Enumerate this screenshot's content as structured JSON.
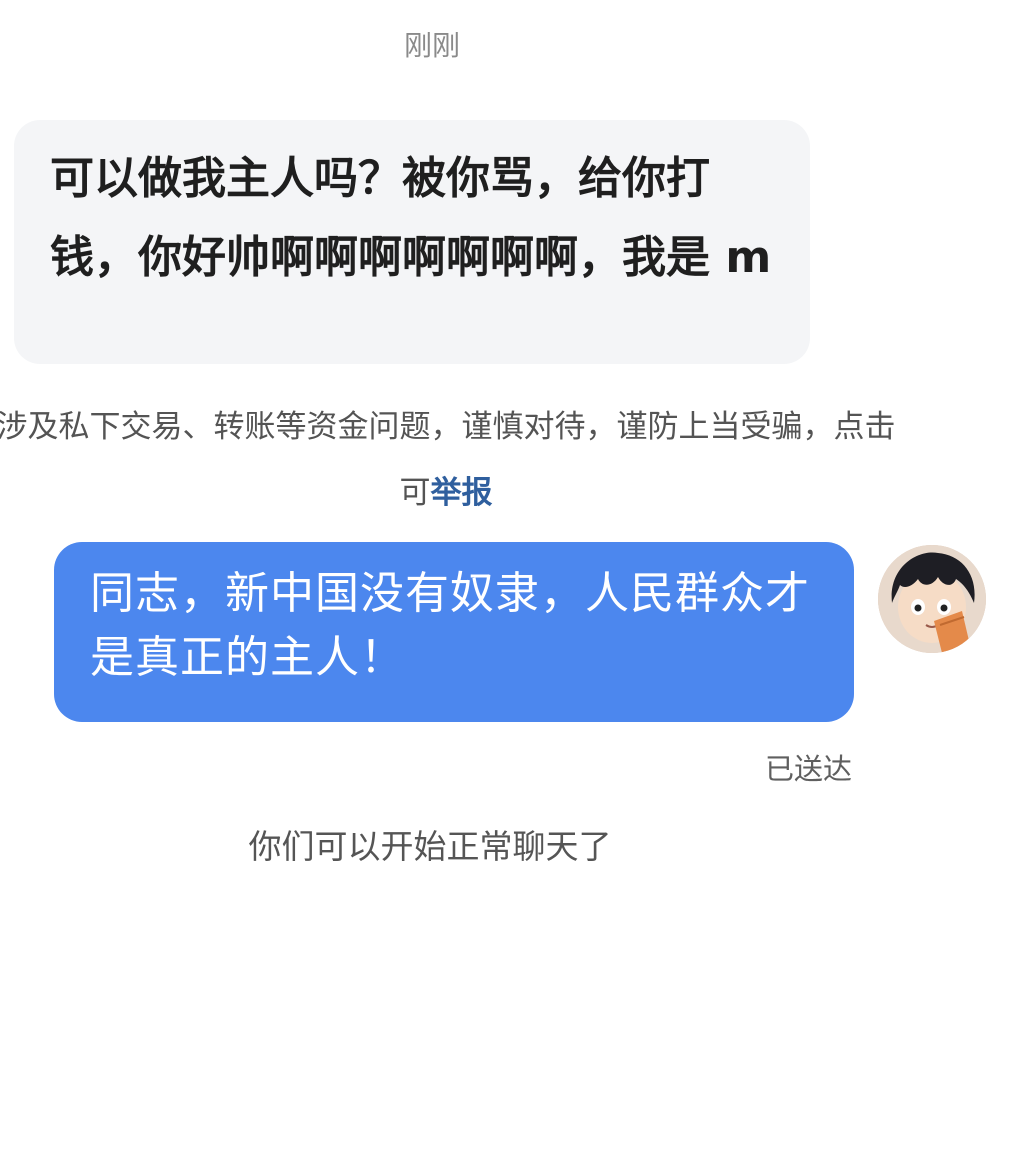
{
  "chat": {
    "timestamp": "刚刚",
    "incoming_message": "可以做我主人吗？被你骂，给你打钱，你好帅啊啊啊啊啊啊啊，我是 m",
    "warning": {
      "text": "涉及私下交易、转账等资金问题，谨慎对待，谨防上当受骗，点击可",
      "link": "举报"
    },
    "outgoing_message": "同志，新中国没有奴隶，人民群众才是真正的主人！",
    "delivery_status": "已送达",
    "system_message": "你们可以开始正常聊天了"
  },
  "colors": {
    "outgoing_bubble": "#4c87ee",
    "incoming_bubble": "#f4f5f7",
    "link": "#2f5f9e"
  },
  "icons": {
    "avatar": "anime-boy-avatar"
  }
}
